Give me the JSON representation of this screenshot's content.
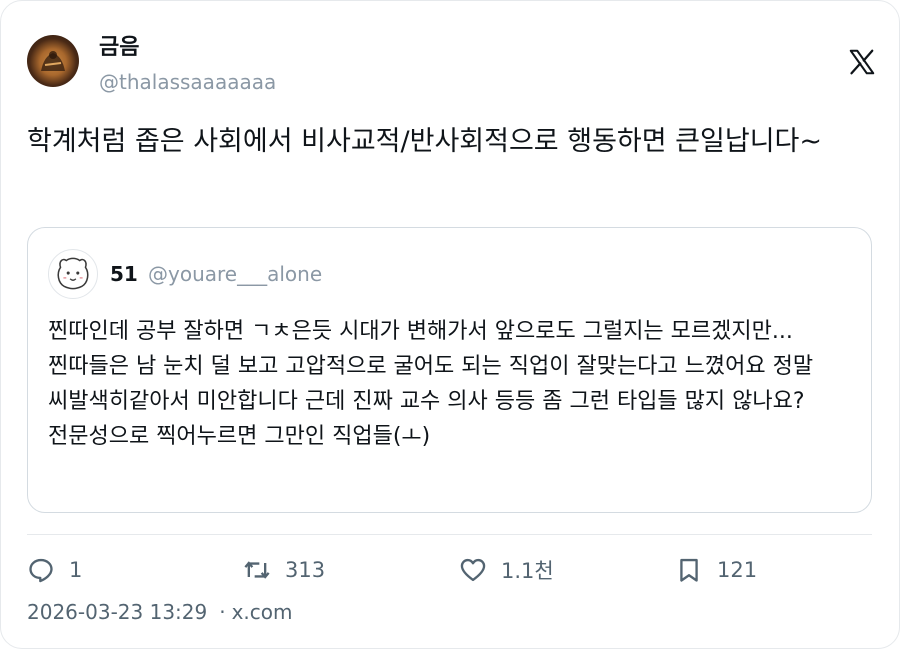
{
  "author": {
    "display_name": "금음",
    "handle": "@thalassaaaaaaa"
  },
  "tweet": {
    "text": "학계처럼 좁은 사회에서 비사교적/반사회적으로 행동하면 큰일납니다~"
  },
  "quoted_tweet": {
    "display_name": "51",
    "handle": "@youare___alone",
    "text": "찐따인데 공부 잘하면 ㄱㅊ은듯 시대가 변해가서 앞으로도 그럴지는 모르겠지만...\n찐따들은 남 눈치 덜 보고 고압적으로 굴어도 되는 직업이 잘맞는다고 느꼈어요 정말 씨발색히같아서 미안합니다 근데 진짜 교수 의사 등등 좀 그런 타입들 많지 않나요? 전문성으로 찍어누르면 그만인 직업들(ㅗ)"
  },
  "actions": {
    "reply_count": "1",
    "retweet_count": "313",
    "like_count": "1.1천",
    "bookmark_count": "121"
  },
  "meta": {
    "timestamp": "2026-03-23 13:29",
    "source": "x.com"
  },
  "icons": {
    "platform": "x-logo-icon",
    "reply": "reply-bubble-icon",
    "retweet": "retweet-icon",
    "like": "heart-icon",
    "bookmark": "bookmark-icon"
  },
  "colors": {
    "text": "#0f1419",
    "secondary_text": "#536471",
    "handle_text": "#8b98a5",
    "border": "#e6e9ec"
  }
}
